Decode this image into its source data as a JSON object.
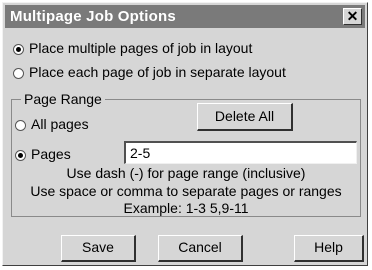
{
  "window": {
    "title": "Multipage Job Options",
    "close_glyph": "✕"
  },
  "layout_options": {
    "place_multiple": "Place multiple pages of job in layout",
    "place_each": "Place each page of job in separate layout",
    "selected": "place_multiple"
  },
  "page_range": {
    "group_label": "Page Range",
    "all_pages_label": "All pages",
    "pages_label": "Pages",
    "pages_value": "2-5",
    "selected": "pages",
    "delete_all_label": "Delete All",
    "help_lines": [
      "Use dash (-) for page range (inclusive)",
      "Use space or comma to separate pages or ranges",
      "Example: 1-3 5,9-11"
    ]
  },
  "buttons": {
    "save": "Save",
    "cancel": "Cancel",
    "help": "Help"
  }
}
